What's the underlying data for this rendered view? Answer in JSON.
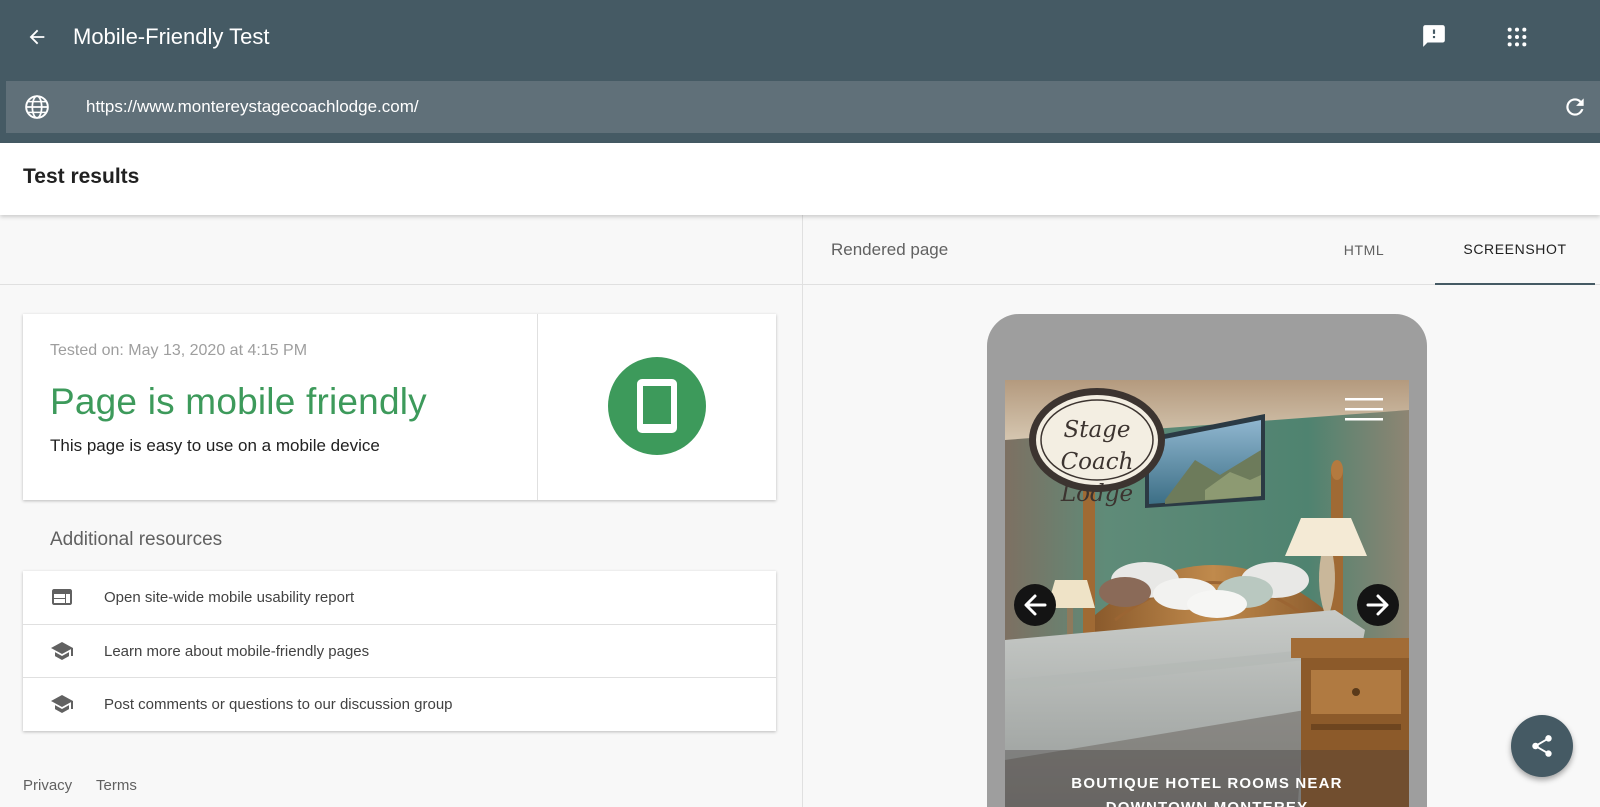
{
  "header": {
    "title": "Mobile-Friendly Test",
    "url": "https://www.montereystagecoachlodge.com/"
  },
  "results": {
    "title": "Test results"
  },
  "summary": {
    "tested_on": "Tested on: May 13, 2020 at 4:15 PM",
    "verdict": "Page is mobile friendly",
    "description": "This page is easy to use on a mobile device",
    "verdict_color": "#3d9a5b"
  },
  "resources": {
    "heading": "Additional resources",
    "items": [
      {
        "label": "Open site-wide mobile usability report",
        "icon": "web-icon"
      },
      {
        "label": "Learn more about mobile-friendly pages",
        "icon": "school-icon"
      },
      {
        "label": "Post comments or questions to our discussion group",
        "icon": "school-icon"
      }
    ]
  },
  "footer": {
    "privacy": "Privacy",
    "terms": "Terms"
  },
  "preview": {
    "label": "Rendered page",
    "tabs": {
      "html": "HTML",
      "screenshot": "SCREENSHOT"
    },
    "active_tab": "SCREENSHOT",
    "site_logo_line1": "Stage Coach",
    "site_logo_line2": "Lodge",
    "caption_line1": "BOUTIQUE HOTEL ROOMS NEAR",
    "caption_line2": "DOWNTOWN MONTEREY"
  },
  "colors": {
    "header": "#455a64",
    "urlbar": "#607079",
    "accent_green": "#3d9a5b"
  }
}
